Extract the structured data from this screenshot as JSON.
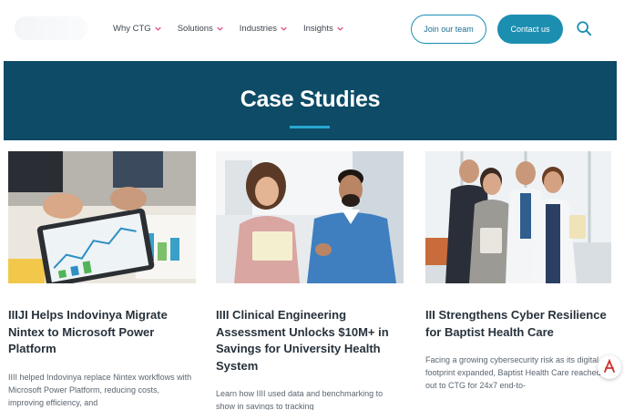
{
  "nav": {
    "items": [
      {
        "label": "Why CTG"
      },
      {
        "label": "Solutions"
      },
      {
        "label": "Industries"
      },
      {
        "label": "Insights"
      }
    ],
    "join_label": "Join our team",
    "contact_label": "Contact us"
  },
  "banner": {
    "title": "Case Studies"
  },
  "cards": [
    {
      "title": "IIIJI Helps Indovinya Migrate Nintex to Microsoft Power Platform",
      "excerpt": "IIII helped Indovinya replace Nintex workflows with Microsoft Power Platform, reducing costs, improving efficiency, and"
    },
    {
      "title": "IIII Clinical Engineering Assessment Unlocks $10M+ in Savings for University Health System",
      "excerpt": "Learn how IIII used data and benchmarking to show in savings to tracking"
    },
    {
      "title": "III Strengthens Cyber Resilience for Baptist Health Care",
      "excerpt": "Facing a growing cybersecurity risk as its digital footprint expanded, Baptist Health Care reached out to CTG for 24x7 end-to-"
    }
  ],
  "colors": {
    "accent": "#1c8fb0",
    "banner": "#0d4b66",
    "nav_chevron": "#e0457b"
  },
  "icons": [
    "chevron-down-icon",
    "search-icon",
    "pdf-icon"
  ]
}
